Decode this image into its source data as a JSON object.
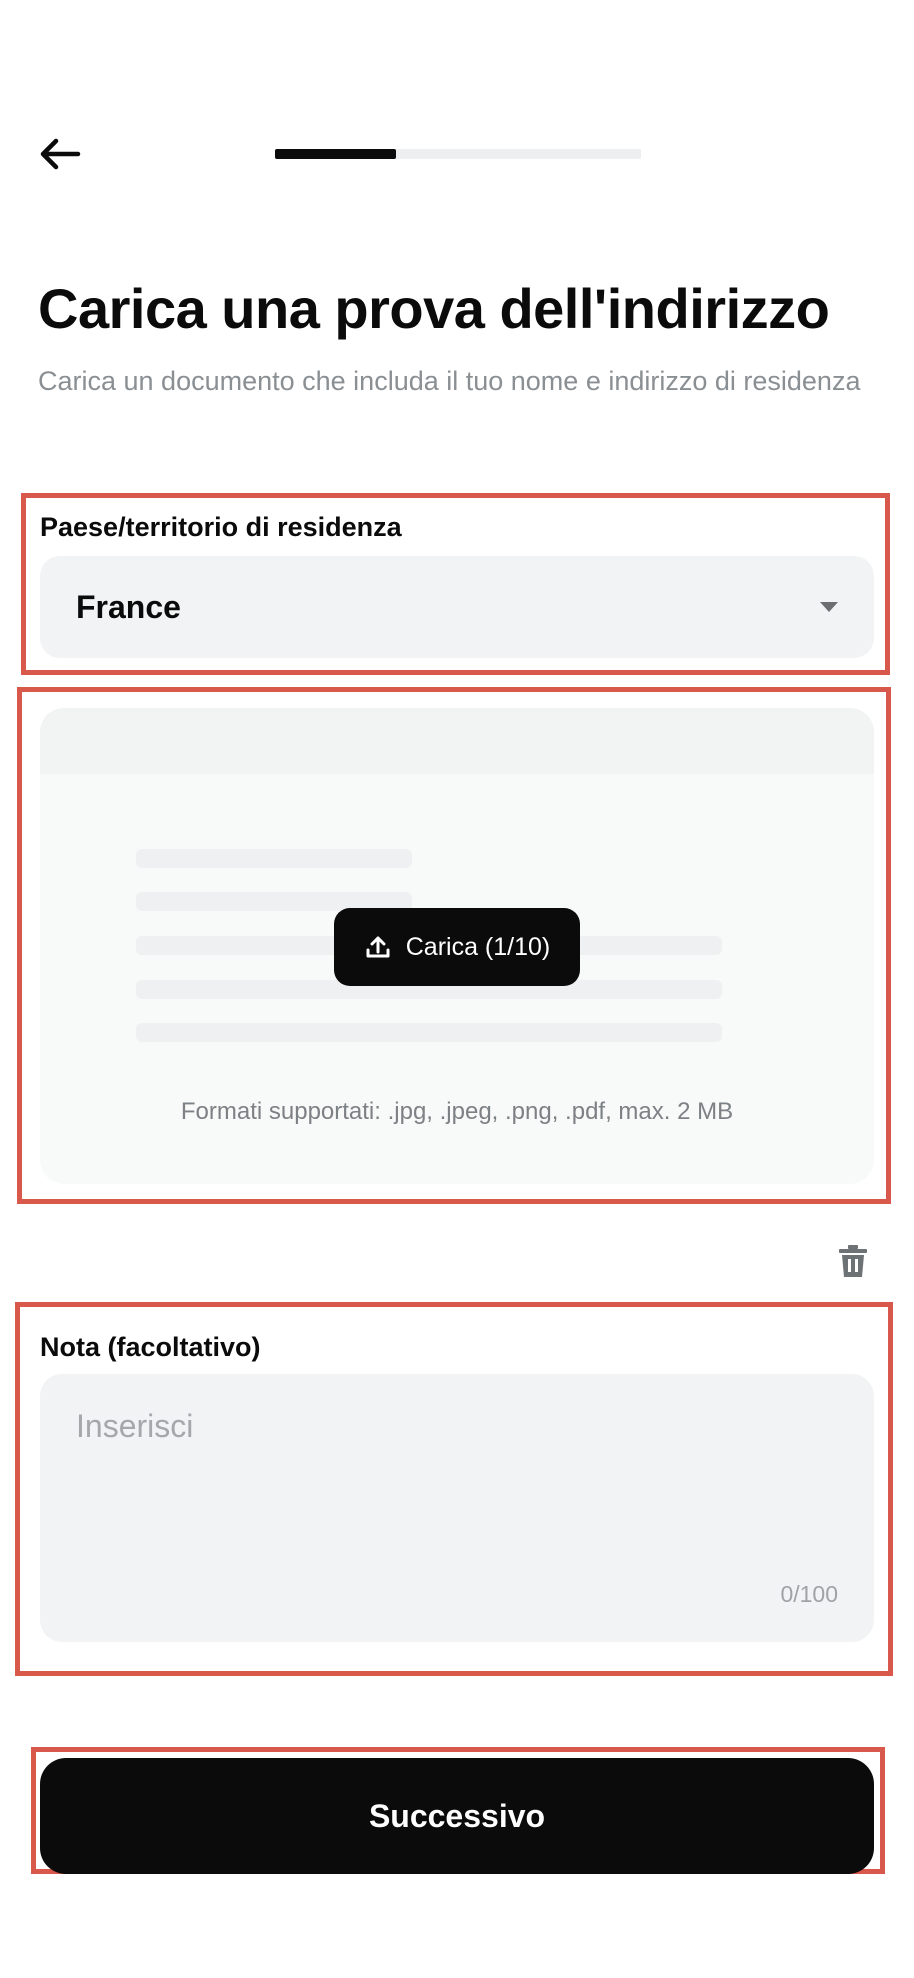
{
  "header": {
    "back_icon": "arrow-left-icon",
    "progress_fraction": 0.33
  },
  "title": "Carica una prova dell'indirizzo",
  "subtitle": "Carica un documento che includa il tuo nome e indirizzo di residenza",
  "country": {
    "label": "Paese/territorio di residenza",
    "value": "France",
    "icon": "caret-down-icon"
  },
  "upload": {
    "button_label": "Carica (1/10)",
    "button_icon": "upload-icon",
    "formats": "Formati supportati: .jpg, .jpeg, .png, .pdf, max. 2 MB",
    "delete_icon": "trash-icon"
  },
  "note": {
    "label": "Nota (facoltativo)",
    "placeholder": "Inserisci",
    "counter": "0/100"
  },
  "next_button": "Successivo",
  "colors": {
    "primary": "#0b0b0b",
    "field_bg": "#f1f3f4",
    "annotation": "#d9584c"
  }
}
